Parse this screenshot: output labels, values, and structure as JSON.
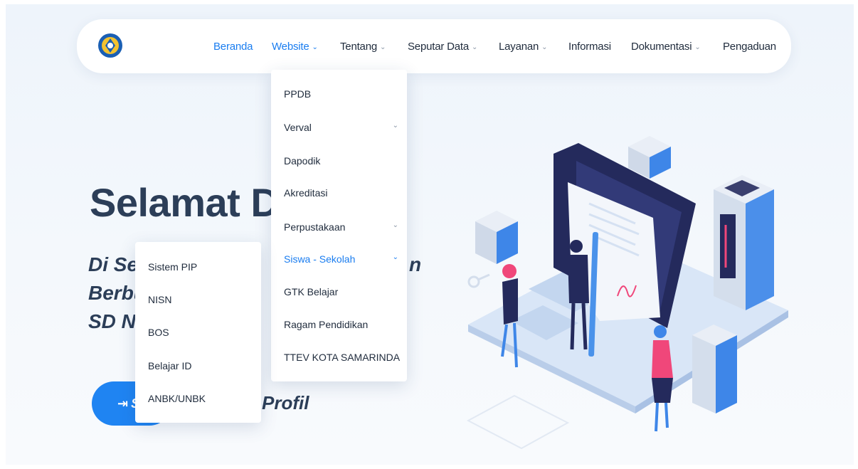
{
  "nav": {
    "items": [
      {
        "label": "Beranda",
        "dropdown": false,
        "active": true
      },
      {
        "label": "Website",
        "dropdown": true,
        "active": true
      },
      {
        "label": "Tentang",
        "dropdown": true,
        "active": false
      },
      {
        "label": "Seputar Data",
        "dropdown": true,
        "active": false
      },
      {
        "label": "Layanan",
        "dropdown": true,
        "active": false
      },
      {
        "label": "Informasi",
        "dropdown": false,
        "active": false
      },
      {
        "label": "Dokumentasi",
        "dropdown": true,
        "active": false
      },
      {
        "label": "Pengaduan",
        "dropdown": false,
        "active": false
      }
    ]
  },
  "website_menu": {
    "items": [
      {
        "label": "PPDB",
        "submenu": false
      },
      {
        "label": "Verval",
        "submenu": true
      },
      {
        "label": "Dapodik",
        "submenu": false
      },
      {
        "label": "Akreditasi",
        "submenu": false
      },
      {
        "label": "Perpustakaan",
        "submenu": true
      },
      {
        "label": "Siswa - Sekolah",
        "submenu": true,
        "active": true
      },
      {
        "label": "GTK Belajar",
        "submenu": false
      },
      {
        "label": "Ragam Pendidikan",
        "submenu": false
      },
      {
        "label": "TTEV KOTA SAMARINDA",
        "submenu": false
      }
    ]
  },
  "siswa_menu": {
    "items": [
      "Sistem PIP",
      "NISN",
      "BOS",
      "Belajar ID",
      "ANBK/UNBK"
    ]
  },
  "hero": {
    "title": "Selamat Da",
    "sub_line1": "Di Se",
    "sub_line1_right": "n",
    "sub_line2": "Berbu",
    "sub_line3": "SD N",
    "primary_button": "S",
    "secondary_button": "Profil"
  },
  "colors": {
    "accent": "#1a7df0",
    "heading": "#2c3e58",
    "illustration_dark": "#242a5c",
    "illustration_blue": "#3e86e8",
    "person_pink": "#f0477a"
  }
}
